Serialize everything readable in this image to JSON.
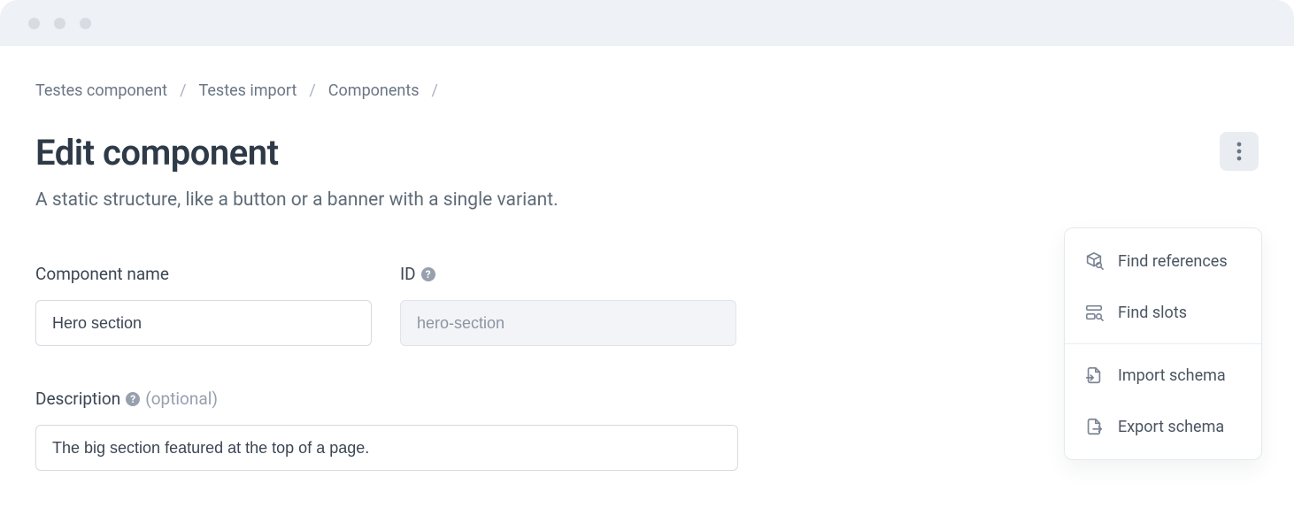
{
  "breadcrumb": {
    "items": [
      "Testes component",
      "Testes import",
      "Components"
    ]
  },
  "page": {
    "title": "Edit component",
    "subtitle": "A static structure, like a button or a banner with a single variant."
  },
  "fields": {
    "name_label": "Component name",
    "name_value": "Hero section",
    "id_label": "ID",
    "id_value": "hero-section",
    "description_label": "Description",
    "optional_hint": "(optional)",
    "description_value": "The big section featured at the top of a page."
  },
  "menu": {
    "find_references": "Find references",
    "find_slots": "Find slots",
    "import_schema": "Import schema",
    "export_schema": "Export schema"
  }
}
